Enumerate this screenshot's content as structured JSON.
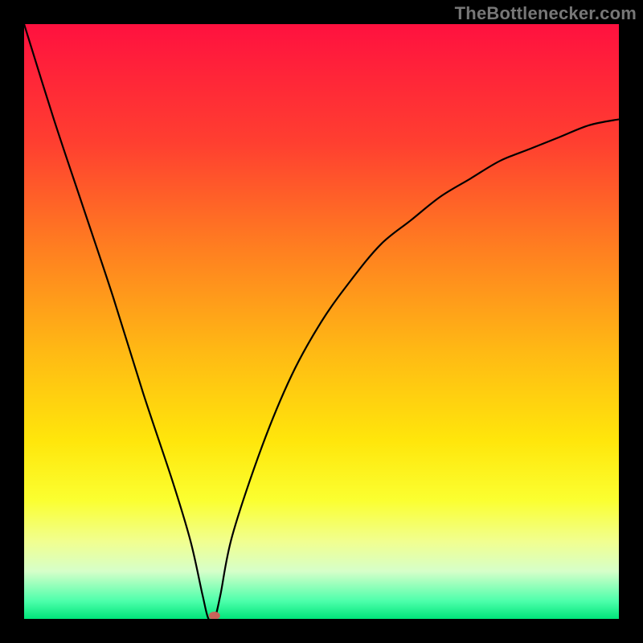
{
  "attribution": "TheBottlenecker.com",
  "chart_data": {
    "type": "line",
    "title": "",
    "xlabel": "",
    "ylabel": "",
    "xlim": [
      0,
      100
    ],
    "ylim": [
      0,
      100
    ],
    "x": [
      0,
      5,
      10,
      15,
      20,
      25,
      28,
      30,
      31,
      32,
      33,
      35,
      40,
      45,
      50,
      55,
      60,
      65,
      70,
      75,
      80,
      85,
      90,
      95,
      100
    ],
    "values": [
      100,
      84,
      69,
      54,
      38,
      23,
      13,
      4,
      0,
      0,
      4,
      14,
      29,
      41,
      50,
      57,
      63,
      67,
      71,
      74,
      77,
      79,
      81,
      83,
      84
    ],
    "marker": {
      "x": 32,
      "y": 0,
      "color": "#c9645a"
    },
    "gradient_stops": [
      {
        "pct": 0,
        "color": "#ff113f"
      },
      {
        "pct": 20,
        "color": "#ff3f30"
      },
      {
        "pct": 37,
        "color": "#ff7c21"
      },
      {
        "pct": 55,
        "color": "#ffb914"
      },
      {
        "pct": 70,
        "color": "#ffe60b"
      },
      {
        "pct": 80,
        "color": "#fbff30"
      },
      {
        "pct": 87,
        "color": "#f1ff90"
      },
      {
        "pct": 92,
        "color": "#d6ffc9"
      },
      {
        "pct": 97,
        "color": "#4dffab"
      },
      {
        "pct": 100,
        "color": "#00e57a"
      }
    ]
  }
}
